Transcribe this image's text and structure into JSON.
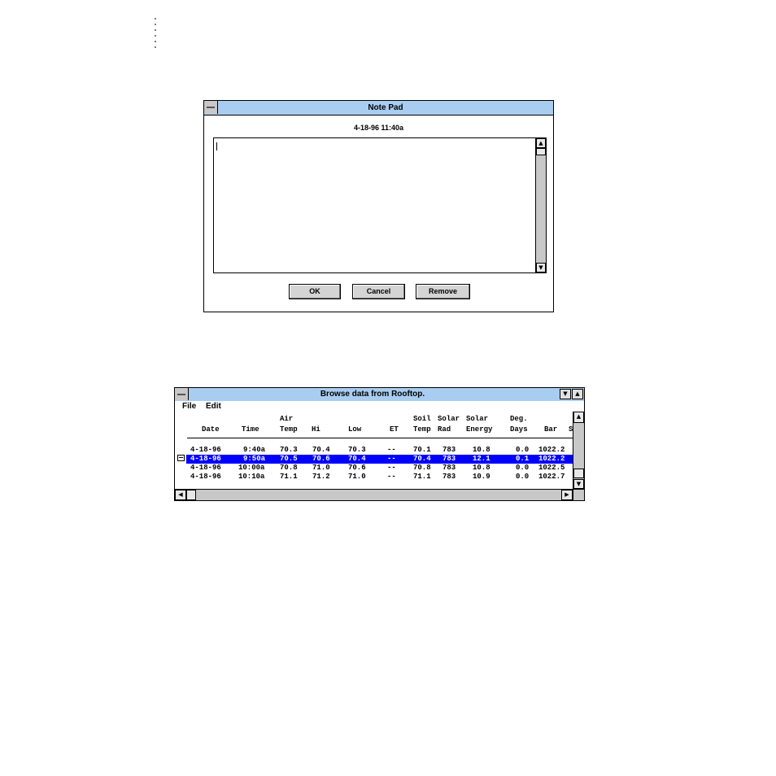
{
  "notepad": {
    "title": "Note Pad",
    "timestamp": "4-18-96 11:40a",
    "text": "",
    "buttons": {
      "ok": "OK",
      "cancel": "Cancel",
      "remove": "Remove"
    },
    "scroll_up_icon": "arrow-up-icon",
    "scroll_down_icon": "arrow-down-icon"
  },
  "browse": {
    "title": "Browse data from Rooftop.",
    "menu": {
      "file": "File",
      "edit": "Edit"
    },
    "columns": [
      {
        "line1": "",
        "line2": "Date"
      },
      {
        "line1": "",
        "line2": "Time"
      },
      {
        "line1": "Air",
        "line2": "Temp"
      },
      {
        "line1": "",
        "line2": "Hi"
      },
      {
        "line1": "",
        "line2": "Low"
      },
      {
        "line1": "",
        "line2": "ET"
      },
      {
        "line1": "Soil",
        "line2": "Temp"
      },
      {
        "line1": "Solar",
        "line2": "Rad"
      },
      {
        "line1": "Solar",
        "line2": "Energy"
      },
      {
        "line1": "Deg.",
        "line2": "Days"
      },
      {
        "line1": "",
        "line2": "Bar"
      },
      {
        "line1": "",
        "line2": "S"
      }
    ],
    "rows": [
      [
        "4-18-96",
        "9:40a",
        "70.3",
        "70.4",
        "70.3",
        "--",
        "70.1",
        "783",
        "10.8",
        "0.0",
        "1022.2"
      ],
      [
        "4-18-96",
        "9:50a",
        "70.5",
        "70.6",
        "70.4",
        "--",
        "70.4",
        "783",
        "12.1",
        "0.1",
        "1022.2"
      ],
      [
        "4-18-96",
        "10:00a",
        "70.8",
        "71.0",
        "70.6",
        "--",
        "70.8",
        "783",
        "10.8",
        "0.0",
        "1022.5"
      ],
      [
        "4-18-96",
        "10:10a",
        "71.1",
        "71.2",
        "71.0",
        "--",
        "71.1",
        "783",
        "10.9",
        "0.0",
        "1022.7"
      ]
    ],
    "selected_row": 1,
    "colors": {
      "selection": "#0000ff",
      "titlebar": "#a9cdf0"
    }
  }
}
